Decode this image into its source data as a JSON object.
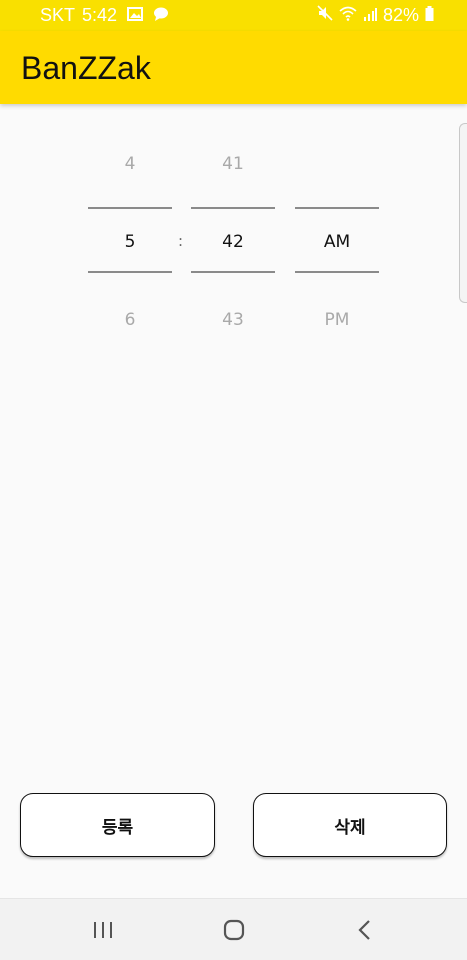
{
  "status_bar": {
    "carrier": "SKT",
    "time": "5:42",
    "battery": "82%",
    "icons": [
      "image-icon",
      "chat-bubble-icon",
      "mute-icon",
      "wifi-icon",
      "signal-icon",
      "battery-icon"
    ]
  },
  "app_bar": {
    "title": "BanZZak",
    "color": "#ffdb00"
  },
  "time_picker": {
    "separator": ":",
    "hour": {
      "prev": "4",
      "selected": "5",
      "next": "6"
    },
    "minute": {
      "prev": "41",
      "selected": "42",
      "next": "43"
    },
    "ampm": {
      "prev": "",
      "selected": "AM",
      "next": "PM"
    }
  },
  "buttons": {
    "register_label": "등록",
    "delete_label": "삭제"
  },
  "nav_bar": {
    "icons": [
      "recent-apps-icon",
      "home-icon",
      "back-icon"
    ]
  }
}
